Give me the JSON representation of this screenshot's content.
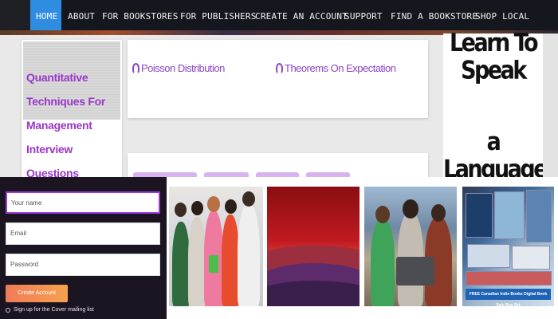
{
  "nav": {
    "items": [
      {
        "label": "HOME",
        "active": true
      },
      {
        "label": "ABOUT"
      },
      {
        "label": "FOR BOOKSTORES"
      },
      {
        "label": "FOR PUBLISHERS"
      },
      {
        "label": "CREATE AN ACCOUNT"
      },
      {
        "label": "SUPPORT"
      },
      {
        "label": "FIND A BOOKSTORE"
      },
      {
        "label": "SHOP LOCAL"
      }
    ],
    "active_color": "#2e8de0"
  },
  "left_card": {
    "title": "Quantitative Techniques For Management Interview Questions"
  },
  "topics": [
    {
      "label": "Poisson Distribution",
      "icon": "question-icon"
    },
    {
      "label": "Theorems On Expectation",
      "icon": "question-icon"
    }
  ],
  "ad": {
    "line1": "Learn To Speak",
    "line2": "a Language"
  },
  "signup": {
    "name_placeholder": "Your name",
    "email_placeholder": "Email",
    "password_placeholder": "Password",
    "button_label": "Create Account",
    "checkbox_label": "Sign up for the Cover mailing list"
  },
  "gallery": {
    "banner_text": "FREE Canadian Indie Books Digital Book Sale Box Set"
  }
}
